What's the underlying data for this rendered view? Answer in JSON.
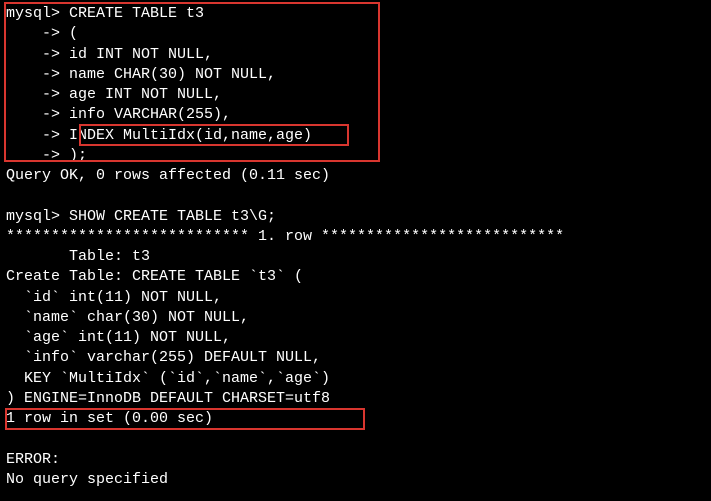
{
  "terminal": {
    "lines": [
      "mysql> CREATE TABLE t3",
      "    -> (",
      "    -> id INT NOT NULL,",
      "    -> name CHAR(30) NOT NULL,",
      "    -> age INT NOT NULL,",
      "    -> info VARCHAR(255),",
      "    -> INDEX MultiIdx(id,name,age)",
      "    -> );",
      "Query OK, 0 rows affected (0.11 sec)",
      "",
      "mysql> SHOW CREATE TABLE t3\\G;",
      "*************************** 1. row ***************************",
      "       Table: t3",
      "Create Table: CREATE TABLE `t3` (",
      "  `id` int(11) NOT NULL,",
      "  `name` char(30) NOT NULL,",
      "  `age` int(11) NOT NULL,",
      "  `info` varchar(255) DEFAULT NULL,",
      "  KEY `MultiIdx` (`id`,`name`,`age`)",
      ") ENGINE=InnoDB DEFAULT CHARSET=utf8",
      "1 row in set (0.00 sec)",
      "",
      "ERROR:",
      "No query specified"
    ]
  }
}
